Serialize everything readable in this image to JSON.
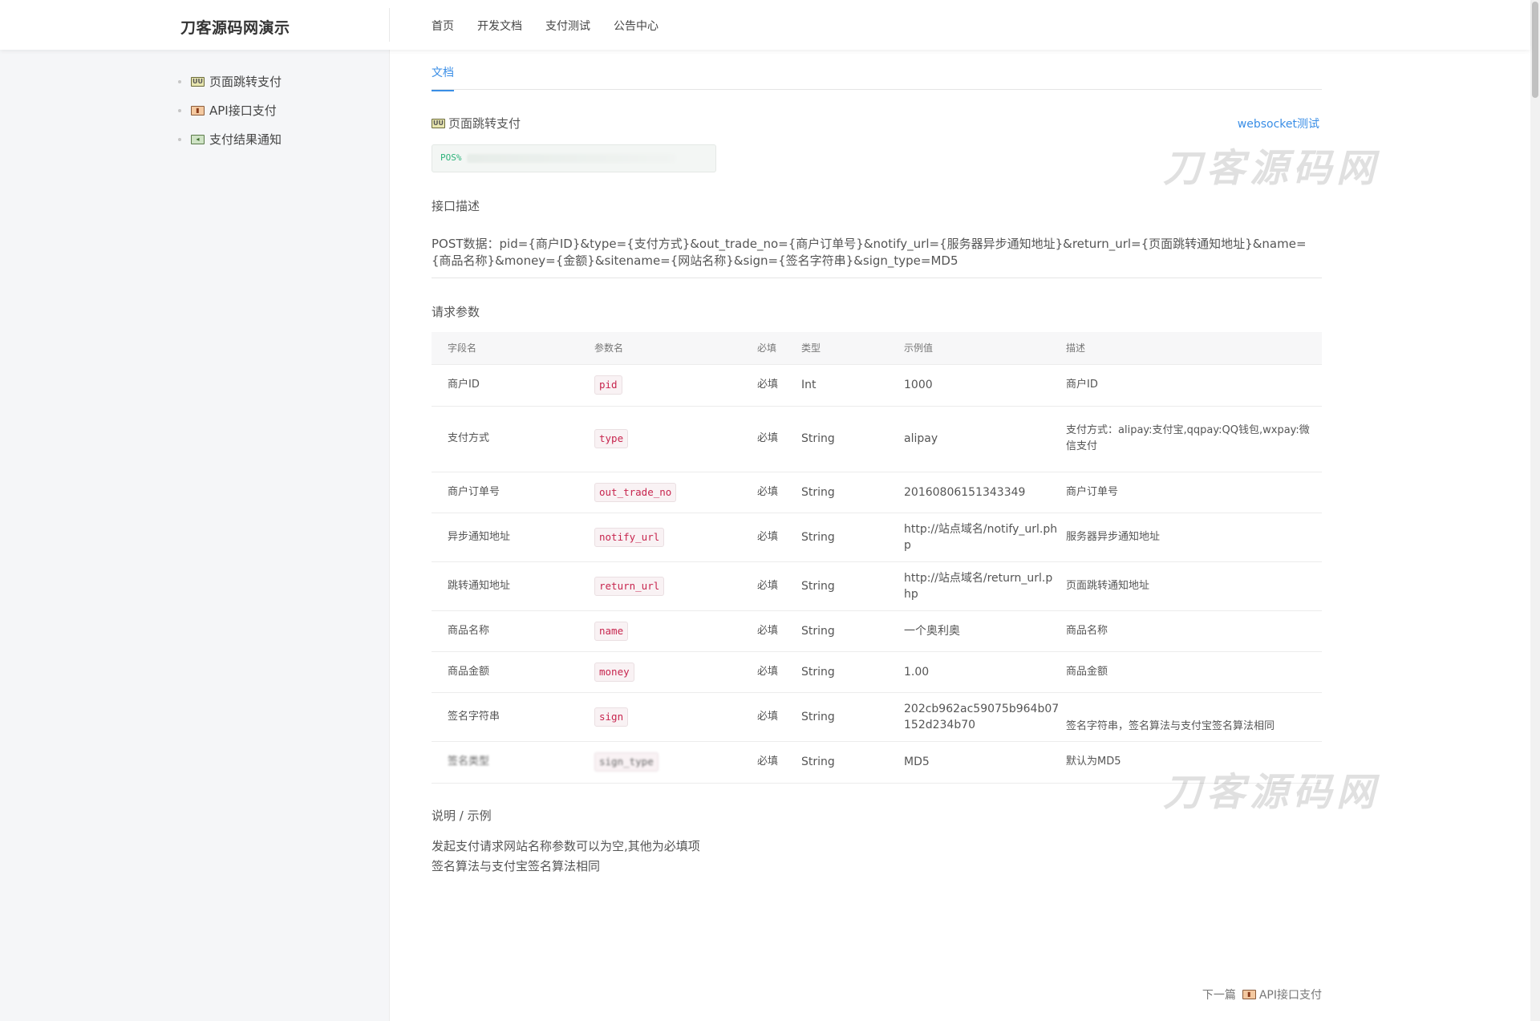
{
  "brand": "刀客源码网演示",
  "topnav": [
    "首页",
    "开发文档",
    "支付测试",
    "公告中心"
  ],
  "sidebar": {
    "items": [
      {
        "label": "页面跳转支付",
        "icon": "page-jump-icon"
      },
      {
        "label": "API接口支付",
        "icon": "api-icon"
      },
      {
        "label": "支付结果通知",
        "icon": "notify-icon"
      }
    ]
  },
  "main": {
    "tab": "文档",
    "section_title": "页面跳转支付",
    "websocket_link": "websocket测试",
    "post_code": "POS%",
    "api_desc_heading": "接口描述",
    "api_desc": "POST数据：pid={商户ID}&type={支付方式}&out_trade_no={商户订单号}&notify_url={服务器异步通知地址}&return_url={页面跳转通知地址}&name={商品名称}&money={金额}&sitename={网站名称}&sign={签名字符串}&sign_type=MD5",
    "params_heading": "请求参数",
    "table": {
      "headers": [
        "字段名",
        "参数名",
        "必填",
        "类型",
        "示例值",
        "描述"
      ],
      "rows": [
        {
          "field": "商户ID",
          "param": "pid",
          "required": "必填",
          "type": "Int",
          "example": "1000",
          "desc": "商户ID"
        },
        {
          "field": "支付方式",
          "param": "type",
          "required": "必填",
          "type": "String",
          "example": "alipay",
          "desc": "支付方式：alipay:支付宝,qqpay:QQ钱包,wxpay:微信支付"
        },
        {
          "field": "商户订单号",
          "param": "out_trade_no",
          "required": "必填",
          "type": "String",
          "example": "20160806151343349",
          "desc": "商户订单号"
        },
        {
          "field": "异步通知地址",
          "param": "notify_url",
          "required": "必填",
          "type": "String",
          "example": "http://站点域名/notify_url.php",
          "desc": "服务器异步通知地址"
        },
        {
          "field": "跳转通知地址",
          "param": "return_url",
          "required": "必填",
          "type": "String",
          "example": "http://站点域名/return_url.php",
          "desc": "页面跳转通知地址"
        },
        {
          "field": "商品名称",
          "param": "name",
          "required": "必填",
          "type": "String",
          "example": "一个奥利奥",
          "desc": "商品名称"
        },
        {
          "field": "商品金额",
          "param": "money",
          "required": "必填",
          "type": "String",
          "example": "1.00",
          "desc": "商品金额"
        },
        {
          "field": "签名字符串",
          "param": "sign",
          "required": "必填",
          "type": "String",
          "example": "202cb962ac59075b964b07152d234b70",
          "desc": "签名字符串，签名算法与支付宝签名算法相同"
        },
        {
          "field": "签名类型",
          "param": "sign_type",
          "required": "必填",
          "type": "String",
          "example": "MD5",
          "desc": "默认为MD5"
        }
      ]
    },
    "notes_heading": "说明 / 示例",
    "notes": [
      "发起支付请求网站名称参数可以为空,其他为必填项",
      "签名算法与支付宝签名算法相同"
    ],
    "next_prefix": "下一篇",
    "next_label": "API接口支付"
  },
  "watermark": "刀客源码网",
  "colors": {
    "accent": "#3a8ee6",
    "code": "#c7254e",
    "post_code": "#2db37a",
    "sidebar_bg": "#f5f6f8"
  }
}
